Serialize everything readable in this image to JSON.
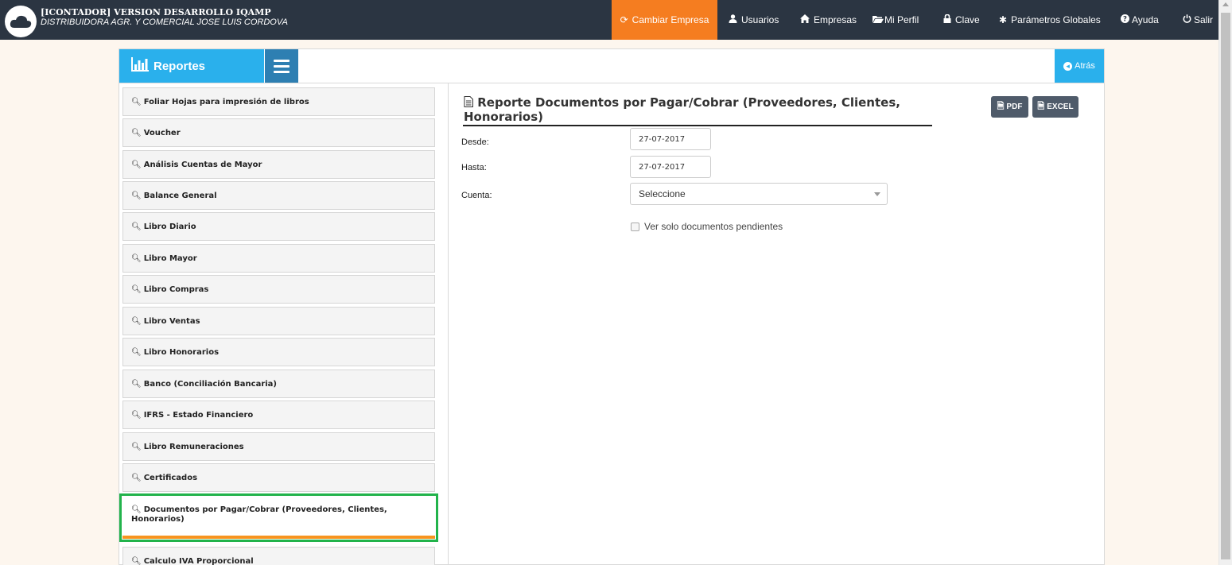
{
  "header": {
    "app_title": "[ICONTADOR] VERSION DESARROLLO IQAMP",
    "company_name": "DISTRIBUIDORA AGR. Y COMERCIAL JOSE LUIS CORDOVA",
    "nav": [
      {
        "label": "Cambiar Empresa",
        "icon": "refresh-icon",
        "active": true
      },
      {
        "label": "Usuarios",
        "icon": "user-icon"
      },
      {
        "label": "Empresas",
        "icon": "home-icon"
      },
      {
        "label": "Mi Perfil",
        "icon": "folder-icon"
      },
      {
        "label": "Clave",
        "icon": "lock-icon"
      },
      {
        "label": "Parámetros Globales",
        "icon": "gear-icon"
      },
      {
        "label": "Ayuda",
        "icon": "help-icon"
      },
      {
        "label": "Salir",
        "icon": "power-icon"
      }
    ],
    "active_color": "#f57d20",
    "bar_color": "#2b3542"
  },
  "panel": {
    "section_title": "Reportes",
    "back_label": "Atrás",
    "accent": "#2ab0ec"
  },
  "sidebar": {
    "items": [
      {
        "label": "Foliar Hojas para impresión de libros"
      },
      {
        "label": "Voucher"
      },
      {
        "label": "Análisis Cuentas de Mayor"
      },
      {
        "label": "Balance General"
      },
      {
        "label": "Libro Diario"
      },
      {
        "label": "Libro Mayor"
      },
      {
        "label": "Libro Compras"
      },
      {
        "label": "Libro Ventas"
      },
      {
        "label": "Libro Honorarios"
      },
      {
        "label": "Banco (Conciliación Bancaria)"
      },
      {
        "label": "IFRS - Estado Financiero"
      },
      {
        "label": "Libro Remuneraciones"
      },
      {
        "label": "Certificados"
      },
      {
        "label": "Documentos por Pagar/Cobrar (Proveedores, Clientes, Honorarios)",
        "active": true
      },
      {
        "label": "Calculo IVA Proporcional"
      }
    ]
  },
  "report": {
    "title": "Reporte Documentos por Pagar/Cobrar (Proveedores, Clientes, Honorarios)",
    "pdf_label": "PDF",
    "excel_label": "EXCEL",
    "desde_label": "Desde:",
    "desde_value": "27-07-2017",
    "hasta_label": "Hasta:",
    "hasta_value": "27-07-2017",
    "cuenta_label": "Cuenta:",
    "cuenta_value": "Seleccione",
    "pending_only_label": "Ver solo documentos pendientes"
  }
}
